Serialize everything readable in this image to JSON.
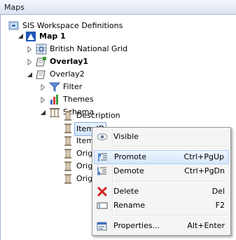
{
  "window": {
    "title": "Maps"
  },
  "tree": {
    "root": "SIS Workspace Definitions",
    "map": "Map 1",
    "bng": "British National Grid",
    "overlay1": "Overlay1",
    "overlay2": "Overlay2",
    "filter": "Filter",
    "themes": "Themes",
    "schema": "Schema",
    "description": "Description",
    "item_id": "Item ID",
    "item2": "Item",
    "orig1": "Origi",
    "orig2": "Origi",
    "orig3": "Origi"
  },
  "menu": {
    "items": [
      {
        "label": "Visible",
        "shortcut": ""
      },
      {
        "label": "Promote",
        "shortcut": "Ctrl+PgUp"
      },
      {
        "label": "Demote",
        "shortcut": "Ctrl+PgDn"
      },
      {
        "label": "Delete",
        "shortcut": "Del"
      },
      {
        "label": "Rename",
        "shortcut": "F2"
      },
      {
        "label": "Properties...",
        "shortcut": "Alt+Enter"
      }
    ],
    "highlighted": "Promote"
  },
  "colors": {
    "accent": "#3a6fc4",
    "highlight": "#d7e7fa",
    "delete": "#d42222"
  }
}
